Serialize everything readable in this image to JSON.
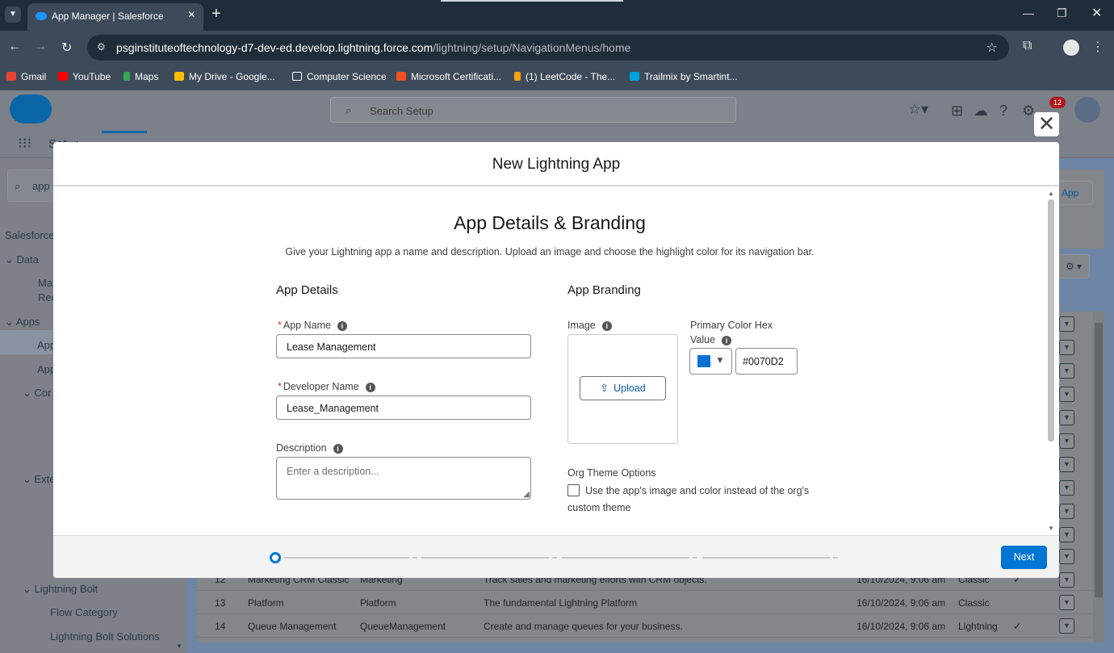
{
  "browser": {
    "tab_title": "App Manager | Salesforce",
    "url_host": "psginstituteoftechnology-d7-dev-ed.develop.lightning.force.com",
    "url_path": "/lightning/setup/NavigationMenus/home",
    "bookmarks": [
      "Gmail",
      "YouTube",
      "Maps",
      "My Drive - Google...",
      "Computer Science",
      "Microsoft Certificati...",
      "(1) LeetCode - The...",
      "Trailmix by Smartint..."
    ]
  },
  "sf": {
    "search_placeholder": "Search Setup",
    "setup_label": "Setup",
    "notifications_count": "12",
    "quickfind_value": "app",
    "new_app_button": "App"
  },
  "left_panel": {
    "items": [
      "Salesforce",
      "Data",
      "Ma",
      "Rec",
      "Apps",
      "App",
      "App",
      "Cor",
      "Exte",
      "Lightning Bolt",
      "Flow Category",
      "Lightning Bolt Solutions"
    ]
  },
  "rows": [
    {
      "num": "12",
      "label": "Marketing CRM Classic",
      "dev": "Marketing",
      "desc": "Track sales and marketing efforts with CRM objects.",
      "date": "16/10/2024, 9:06 am",
      "type": "Classic",
      "check": "✓"
    },
    {
      "num": "13",
      "label": "Platform",
      "dev": "Platform",
      "desc": "The fundamental Lightning Platform",
      "date": "16/10/2024, 9:06 am",
      "type": "Classic",
      "check": ""
    },
    {
      "num": "14",
      "label": "Queue Management",
      "dev": "QueueManagement",
      "desc": "Create and manage queues for your business.",
      "date": "16/10/2024, 9:06 am",
      "type": "Lightning",
      "check": "✓"
    }
  ],
  "modal": {
    "title": "New Lightning App",
    "section_title": "App Details & Branding",
    "section_subtitle": "Give your Lightning app a name and description. Upload an image and choose the highlight color for its navigation bar.",
    "details_title": "App Details",
    "branding_title": "App Branding",
    "app_name_label": "App Name",
    "app_name_value": "Lease Management",
    "dev_name_label": "Developer Name",
    "dev_name_value": "Lease_Management",
    "description_label": "Description",
    "description_placeholder": "Enter a description...",
    "image_label": "Image",
    "upload_label": "Upload",
    "color_label_1": "Primary Color Hex",
    "color_label_2": "Value",
    "color_value": "#0070D2",
    "org_theme_label": "Org Theme Options",
    "org_theme_checkbox": "Use the app's image and color instead of the org's custom theme",
    "next_label": "Next",
    "progress_value": 0
  },
  "colors": {
    "primary": "#0070d2",
    "brand_button": "#0176d3"
  }
}
